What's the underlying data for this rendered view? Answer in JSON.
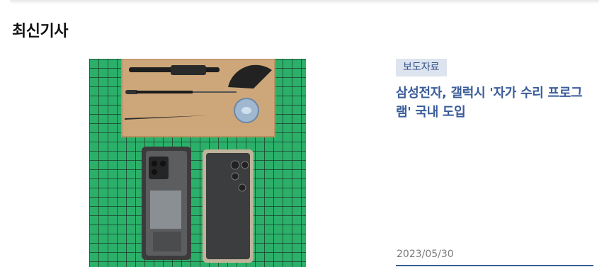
{
  "section": {
    "title": "최신기사"
  },
  "article": {
    "category": "보도자료",
    "title": "삼성전자, 갤럭시 '자가 수리 프로그램' 국내 도입",
    "date": "2023/05/30"
  },
  "colors": {
    "accent": "#3a5c99",
    "badge_bg": "#dde4ef",
    "mat_green": "#2bb06a",
    "date_gray": "#7b7b7b"
  }
}
